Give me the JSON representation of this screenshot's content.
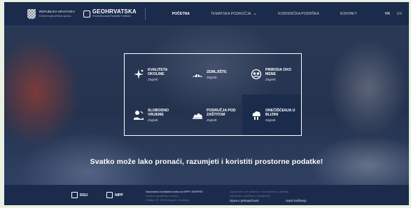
{
  "header": {
    "brand_line1": "REPUBLIKA HRVATSKA",
    "brand_line2": "Državna geodetska uprava",
    "geo_title": "GEOHRVATSKA",
    "geo_subtitle": "Prostorni podaci Republike Hrvatske",
    "nav": [
      {
        "label": "POČETNA",
        "active": true
      },
      {
        "label": "TEMATSKA PODRUČJA",
        "active": false,
        "dropdown": true
      },
      {
        "label": "KORISNIČKA PODRŠKA",
        "active": false
      },
      {
        "label": "KONTAKT",
        "active": false
      }
    ],
    "lang": [
      "HR",
      "EN"
    ]
  },
  "tiles": [
    {
      "title": "KVALITETA OKOLINE",
      "subtitle": "Zagreb",
      "icon": "sparkle-icon"
    },
    {
      "title": "ZEMLJIŠTE",
      "subtitle": "Zagreb",
      "icon": "land-icon"
    },
    {
      "title": "PRIRODA OKO MENE",
      "subtitle": "Zagreb",
      "icon": "nature-icon"
    },
    {
      "title": "SLOBODNO VRIJEME",
      "subtitle": "Zagreb",
      "icon": "leisure-icon"
    },
    {
      "title": "PODRUČJA POD ZAŠTITOM",
      "subtitle": "Zagreb",
      "icon": "protected-area-icon"
    },
    {
      "title": "ONEČIŠĆENJA U BLIZINI",
      "subtitle": "Zagreb",
      "icon": "pollution-icon"
    }
  ],
  "tagline": "Svatko može lako pronaći, razumjeti i koristiti prostorne podatke!",
  "footer": {
    "logo1": "DGU",
    "logo2": "NIPP",
    "col1": [
      "Nacionalna kontaktna točka za NIPP i INSPIRE",
      "Državna geodetska uprava",
      "Gruška 20, 10000 Zagreb, Hrvatska"
    ],
    "col2": [
      "Upotrebom ove stranice, Vi se slažete s uvjetima",
      "korištenja i pravilima o privatnosti"
    ],
    "link1": "Izjava o pristupačnosti",
    "link2": "Uvjeti korištenja"
  },
  "colors": {
    "nav_bg": "#1a2b4c",
    "tile_dark": "#18284a",
    "accent": "#ffffff"
  }
}
